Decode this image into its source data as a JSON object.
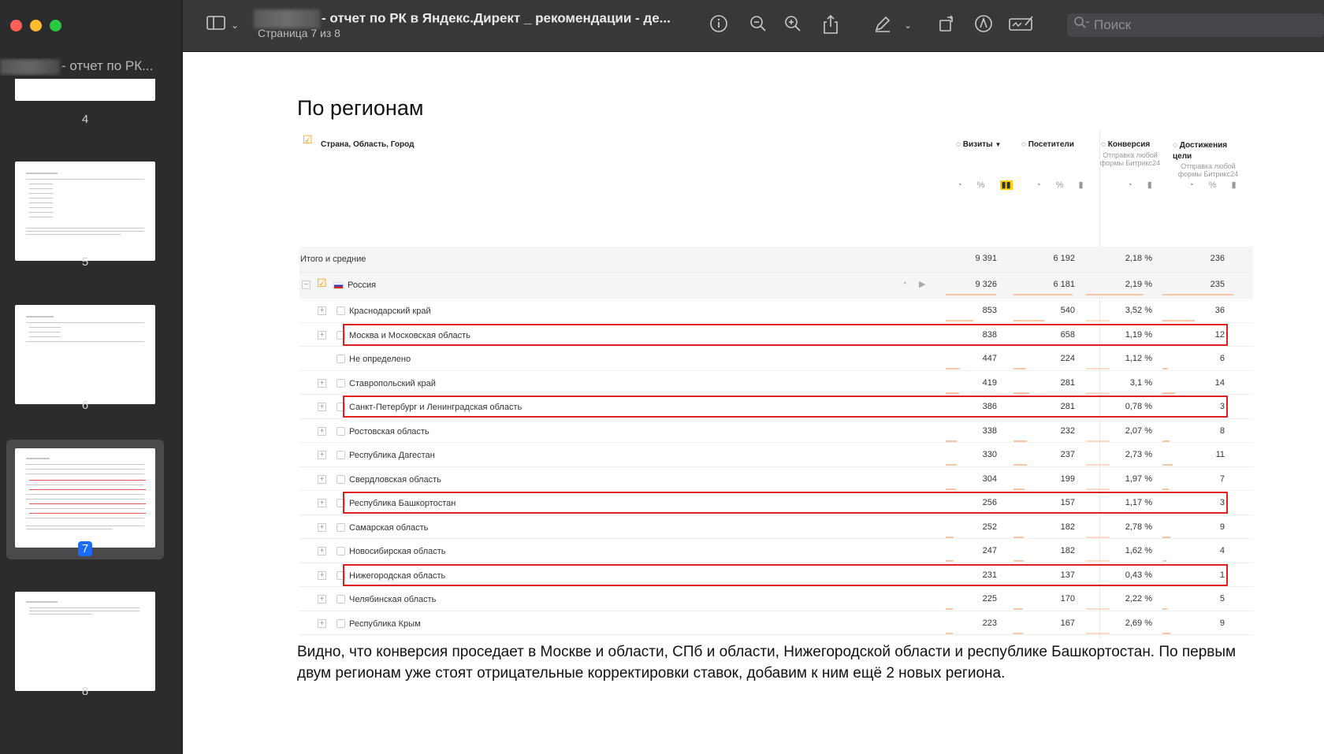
{
  "sidebar": {
    "title": "- отчет по РК...",
    "pages": [
      {
        "num": "4",
        "active": false
      },
      {
        "num": "5",
        "active": false
      },
      {
        "num": "6",
        "active": false
      },
      {
        "num": "7",
        "active": true
      },
      {
        "num": "8",
        "active": false
      }
    ]
  },
  "toolbar": {
    "title": "- отчет по РК в Яндекс.Директ _ рекомендации - де...",
    "subtitle": "Страница 7 из 8",
    "search_placeholder": "Поиск",
    "icons": [
      "sidebar-toggle-icon",
      "chevron-down-icon",
      "info-icon",
      "zoom-out-icon",
      "zoom-in-icon",
      "share-icon",
      "markup-pen-icon",
      "chevron-down-icon",
      "rotate-icon",
      "markup-icon",
      "signature-icon",
      "search-icon"
    ]
  },
  "page": {
    "heading": "По регионам",
    "table": {
      "dimension_label": "Страна, Область, Город",
      "columns": [
        {
          "label": "Визиты",
          "sort": "▼",
          "sub": ""
        },
        {
          "label": "Посетители",
          "sub": ""
        },
        {
          "label": "Конверсия",
          "sub": "Отправка любой формы Битрикс24"
        },
        {
          "label": "Достижения цели",
          "sub": "Отправка любой формы Битрикс24"
        }
      ],
      "total": {
        "label": "Итого и средние",
        "values": [
          "9 391",
          "6 192",
          "2,18 %",
          "236"
        ]
      },
      "country": {
        "label": "Россия",
        "values": [
          "9 326",
          "6 181",
          "2,19 %",
          "235"
        ]
      },
      "rows": [
        {
          "label": "Краснодарский край",
          "values": [
            "853",
            "540",
            "3,52 %",
            "36"
          ],
          "highlight": false,
          "expandable": true
        },
        {
          "label": "Москва и Московская область",
          "values": [
            "838",
            "658",
            "1,19 %",
            "12"
          ],
          "highlight": true,
          "expandable": true
        },
        {
          "label": "Не определено",
          "values": [
            "447",
            "224",
            "1,12 %",
            "6"
          ],
          "highlight": false,
          "expandable": false
        },
        {
          "label": "Ставропольский край",
          "values": [
            "419",
            "281",
            "3,1 %",
            "14"
          ],
          "highlight": false,
          "expandable": true
        },
        {
          "label": "Санкт-Петербург и Ленинградская область",
          "values": [
            "386",
            "281",
            "0,78 %",
            "3"
          ],
          "highlight": true,
          "expandable": true
        },
        {
          "label": "Ростовская область",
          "values": [
            "338",
            "232",
            "2,07 %",
            "8"
          ],
          "highlight": false,
          "expandable": true
        },
        {
          "label": "Республика Дагестан",
          "values": [
            "330",
            "237",
            "2,73 %",
            "11"
          ],
          "highlight": false,
          "expandable": true
        },
        {
          "label": "Свердловская область",
          "values": [
            "304",
            "199",
            "1,97 %",
            "7"
          ],
          "highlight": false,
          "expandable": true
        },
        {
          "label": "Республика Башкортостан",
          "values": [
            "256",
            "157",
            "1,17 %",
            "3"
          ],
          "highlight": true,
          "expandable": true
        },
        {
          "label": "Самарская область",
          "values": [
            "252",
            "182",
            "2,78 %",
            "9"
          ],
          "highlight": false,
          "expandable": true
        },
        {
          "label": "Новосибирская область",
          "values": [
            "247",
            "182",
            "1,62 %",
            "4"
          ],
          "highlight": false,
          "expandable": true
        },
        {
          "label": "Нижегородская область",
          "values": [
            "231",
            "137",
            "0,43 %",
            "1"
          ],
          "highlight": true,
          "expandable": true
        },
        {
          "label": "Челябинская область",
          "values": [
            "225",
            "170",
            "2,22 %",
            "5"
          ],
          "highlight": false,
          "expandable": true
        },
        {
          "label": "Республика Крым",
          "values": [
            "223",
            "167",
            "2,69 %",
            "9"
          ],
          "highlight": false,
          "expandable": true
        }
      ]
    },
    "paragraph": "Видно, что конверсия проседает в Москве и области, СПб и области, Нижегородской области и республике Башкортостан. По первым двум регионам уже стоят отрицательные корректировки ставок, добавим к ним ещё 2 новых региона."
  },
  "colors": {
    "highlight": "#e02020",
    "active_page": "#1b6bff",
    "bar": "#f6c7a4"
  }
}
